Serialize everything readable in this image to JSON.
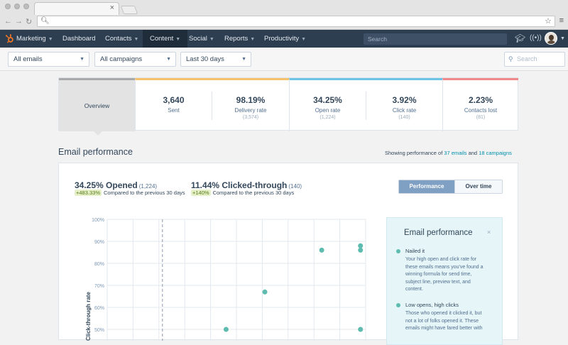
{
  "browser": {
    "url": "",
    "tab_close": "×"
  },
  "nav": {
    "brand": "Marketing",
    "items": [
      {
        "label": "Dashboard",
        "dropdown": false
      },
      {
        "label": "Contacts",
        "dropdown": true
      },
      {
        "label": "Content",
        "dropdown": true,
        "active": true
      },
      {
        "label": "Social",
        "dropdown": true
      },
      {
        "label": "Reports",
        "dropdown": true
      },
      {
        "label": "Productivity",
        "dropdown": true
      }
    ],
    "search_placeholder": "Search"
  },
  "filters": {
    "emails": "All emails",
    "campaigns": "All campaigns",
    "date_range": "Last 30 days",
    "search_placeholder": "Search"
  },
  "stats": {
    "overview_label": "Overview",
    "items": [
      {
        "value": "3,640",
        "label": "Sent",
        "count": ""
      },
      {
        "value": "98.19%",
        "label": "Delivery rate",
        "count": "(3,574)"
      },
      {
        "value": "34.25%",
        "label": "Open rate",
        "count": "(1,224)"
      },
      {
        "value": "3.92%",
        "label": "Click rate",
        "count": "(140)"
      },
      {
        "value": "2.23%",
        "label": "Contacts lost",
        "count": "(81)"
      }
    ],
    "colors": {
      "overview": "#a9a9a9",
      "sent": "#f5c26b",
      "open": "#6cc5e6",
      "lost": "#f2878a"
    }
  },
  "section": {
    "title": "Email performance",
    "note_prefix": "Showing performance of ",
    "emails_link": "37 emails",
    "note_mid": " and ",
    "campaigns_link": "18 campaigns"
  },
  "performance": {
    "opened": {
      "value": "34.25% Opened",
      "count": "(1,224)",
      "change": "+483.33%",
      "compare": "Compared to the previous 30 days"
    },
    "clicked": {
      "value": "11.44% Clicked-through",
      "count": "(140)",
      "change": "+140%",
      "compare": "Compared to the previous 30 days"
    },
    "toggle": {
      "performance": "Performance",
      "over_time": "Over time"
    }
  },
  "chart_data": {
    "type": "scatter",
    "ylabel": "Click-through rate",
    "y_ticks": [
      "100%",
      "90%",
      "80%",
      "70%",
      "60%",
      "50%"
    ],
    "ylim_visible": [
      50,
      100
    ],
    "reference_line": "dashed vertical line marking average open rate",
    "points": [
      {
        "x_frac": 0.83,
        "y": 86
      },
      {
        "x_frac": 0.98,
        "y": 88
      },
      {
        "x_frac": 0.98,
        "y": 86
      },
      {
        "x_frac": 0.61,
        "y": 67
      },
      {
        "x_frac": 0.46,
        "y": 50
      },
      {
        "x_frac": 0.98,
        "y": 50
      }
    ],
    "point_color": "#5dbcaf"
  },
  "info": {
    "title": "Email performance",
    "close": "×",
    "items": [
      {
        "heading": "Nailed it",
        "lines": [
          "Your high open and click rate for",
          "these emails means you've found a",
          "winning formula for send time,",
          "subject line, preview text, and",
          "content."
        ]
      },
      {
        "heading": "Low opens, high clicks",
        "lines": [
          "Those who opened it clicked it, but",
          "not a lot of folks opened it. These",
          "emails might have fared better with"
        ]
      }
    ]
  }
}
